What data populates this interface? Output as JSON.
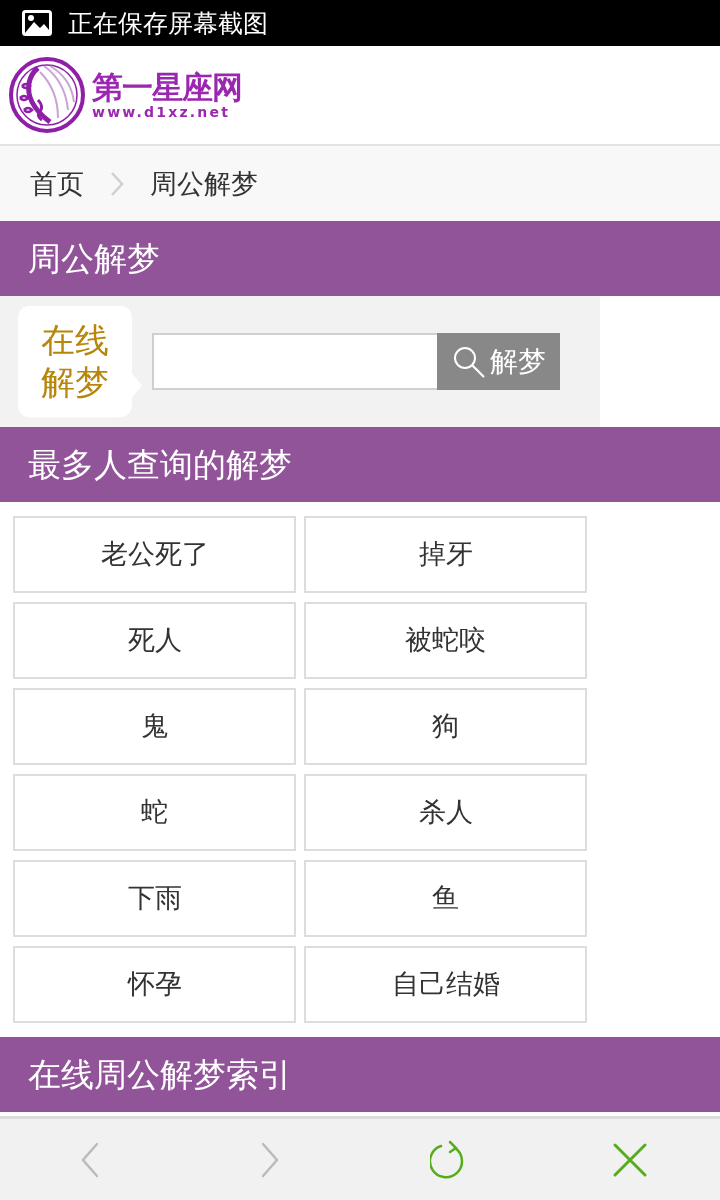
{
  "status_bar": {
    "text": "正在保存屏幕截图"
  },
  "site_header": {
    "logo_title": "第一星座网",
    "logo_url": "www.d1xz.net"
  },
  "breadcrumb": [
    {
      "label": "首页"
    },
    {
      "label": "周公解梦"
    }
  ],
  "page_heading": "周公解梦",
  "search": {
    "label": "在线解梦",
    "button": "解梦"
  },
  "popular": {
    "title": "最多人查询的解梦",
    "items": [
      {
        "label": "老公死了"
      },
      {
        "label": "掉牙"
      },
      {
        "label": "死人"
      },
      {
        "label": "被蛇咬"
      },
      {
        "label": "鬼"
      },
      {
        "label": "狗"
      },
      {
        "label": "蛇"
      },
      {
        "label": "杀人"
      },
      {
        "label": "下雨"
      },
      {
        "label": "鱼"
      },
      {
        "label": "怀孕"
      },
      {
        "label": "自己结婚"
      }
    ]
  },
  "index_section": {
    "title": "在线周公解梦索引"
  },
  "browser_toolbar": [
    {
      "kind": "back",
      "disabled": true
    },
    {
      "kind": "forward",
      "disabled": true
    },
    {
      "kind": "reload",
      "disabled": false
    },
    {
      "kind": "close",
      "disabled": false
    }
  ]
}
